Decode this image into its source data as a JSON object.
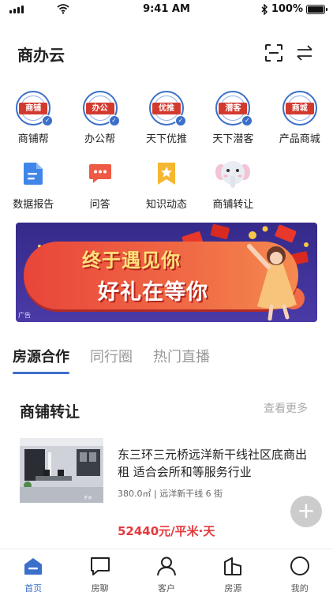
{
  "status_bar": {
    "time": "9:41 AM",
    "battery": "100%",
    "battery_level": 1.0
  },
  "header": {
    "title": "商办云"
  },
  "partner_apps": [
    {
      "label": "商铺帮",
      "stamp_text": "商铺"
    },
    {
      "label": "办公帮",
      "stamp_text": "办公"
    },
    {
      "label": "天下优推",
      "stamp_text": "优推"
    },
    {
      "label": "天下潜客",
      "stamp_text": "潜客"
    },
    {
      "label": "产品商城",
      "stamp_text": "商城"
    }
  ],
  "functions": [
    {
      "label": "数据报告",
      "icon": "document-icon"
    },
    {
      "label": "问答",
      "icon": "chat-icon"
    },
    {
      "label": "知识动态",
      "icon": "bookmark-star-icon"
    },
    {
      "label": "商铺转让",
      "icon": "elephant-mascot-icon"
    }
  ],
  "banner": {
    "line1": "终于遇见你",
    "line2": "好礼在等你",
    "ad_label": "广告"
  },
  "tabs": [
    {
      "label": "房源合作",
      "active": true
    },
    {
      "label": "同行圈",
      "active": false
    },
    {
      "label": "热门直播",
      "active": false
    }
  ],
  "section": {
    "title": "商铺转让",
    "see_more": "查看更多"
  },
  "listing": {
    "title": "东三环三元桥远洋新干线社区底商出租 适合会所和等服务行业",
    "meta": "380.0㎡ | 远洋新干线 6 街",
    "price": "52440元/平米·天"
  },
  "fab": {
    "label": "+"
  },
  "bottom_nav": [
    {
      "label": "首页",
      "icon": "home-icon",
      "active": true
    },
    {
      "label": "房聊",
      "icon": "chat-bubble-icon",
      "active": false
    },
    {
      "label": "客户",
      "icon": "person-icon",
      "active": false
    },
    {
      "label": "房源",
      "icon": "building-icon",
      "active": false
    },
    {
      "label": "我的",
      "icon": "profile-circle-icon",
      "active": false
    }
  ],
  "colors": {
    "accent": "#3b6fc9",
    "price": "#e4393c",
    "stamp_red": "#d33a2e"
  }
}
